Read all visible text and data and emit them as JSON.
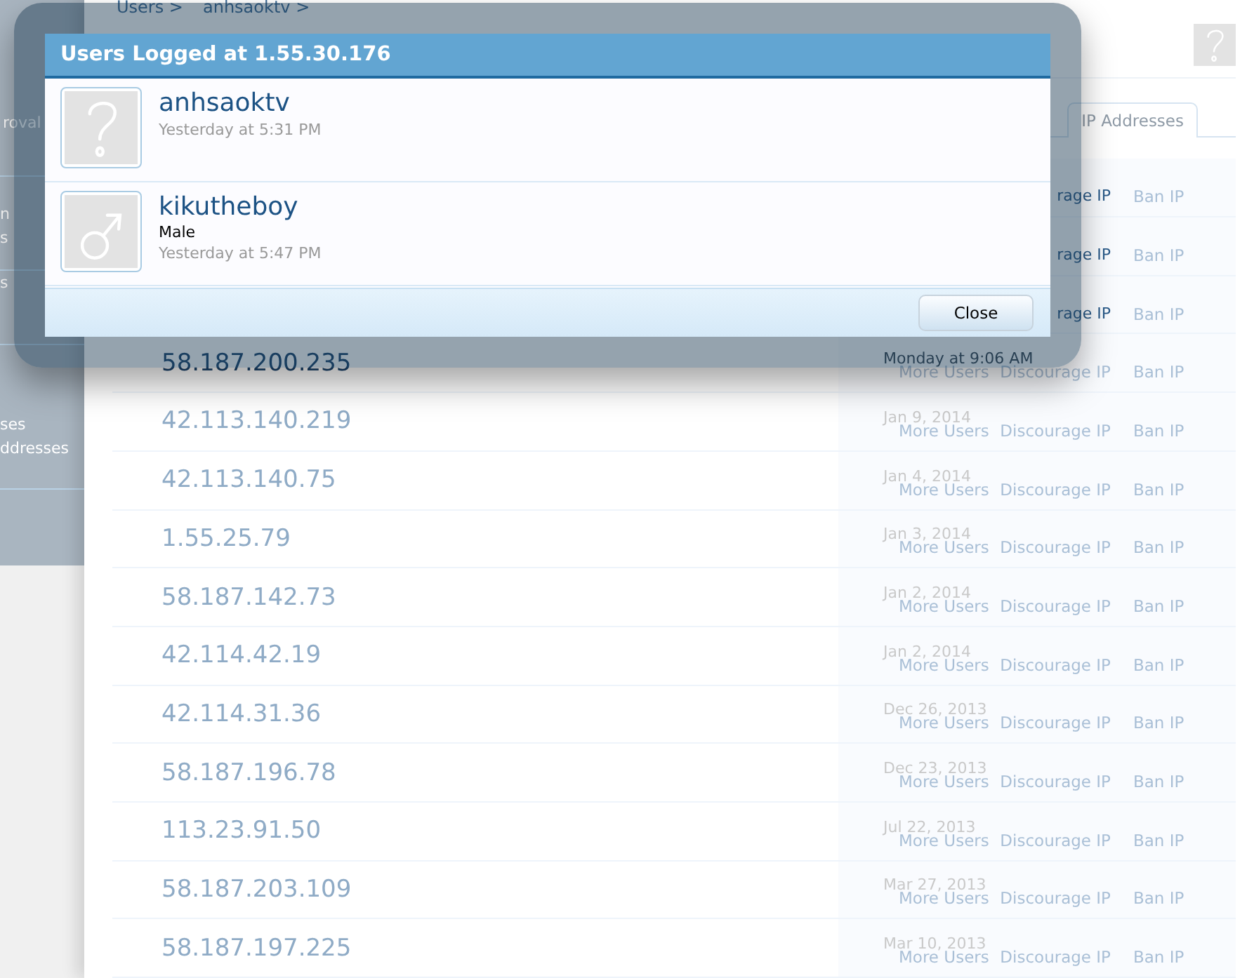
{
  "breadcrumb": [
    {
      "label": "Users >"
    },
    {
      "label": "anhsaoktv >"
    }
  ],
  "sidebar": {
    "sections": [
      {
        "items": [
          "roval"
        ]
      },
      {
        "items": [
          "n",
          "s"
        ]
      },
      {
        "items": [
          "s"
        ]
      },
      {
        "items": [
          "ses",
          "ddresses"
        ]
      }
    ]
  },
  "tabs": [
    {
      "label": "IP Addresses",
      "selected": true
    }
  ],
  "ip_rows": [
    {
      "discourage": "rage IP",
      "ban": "Ban IP"
    },
    {
      "discourage": "rage IP",
      "ban": "Ban IP"
    },
    {
      "discourage": "rage IP",
      "ban": "Ban IP"
    },
    {
      "ip": "58.187.200.235",
      "date": "Monday at 9:06 AM",
      "more": "More Users",
      "discourage": "Discourage IP",
      "ban": "Ban IP"
    },
    {
      "ip": "42.113.140.219",
      "date": "Jan 9, 2014",
      "more": "More Users",
      "discourage": "Discourage IP",
      "ban": "Ban IP"
    },
    {
      "ip": "42.113.140.75",
      "date": "Jan 4, 2014",
      "more": "More Users",
      "discourage": "Discourage IP",
      "ban": "Ban IP"
    },
    {
      "ip": "1.55.25.79",
      "date": "Jan 3, 2014",
      "more": "More Users",
      "discourage": "Discourage IP",
      "ban": "Ban IP"
    },
    {
      "ip": "58.187.142.73",
      "date": "Jan 2, 2014",
      "more": "More Users",
      "discourage": "Discourage IP",
      "ban": "Ban IP"
    },
    {
      "ip": "42.114.42.19",
      "date": "Jan 2, 2014",
      "more": "More Users",
      "discourage": "Discourage IP",
      "ban": "Ban IP"
    },
    {
      "ip": "42.114.31.36",
      "date": "Dec 26, 2013",
      "more": "More Users",
      "discourage": "Discourage IP",
      "ban": "Ban IP"
    },
    {
      "ip": "58.187.196.78",
      "date": "Dec 23, 2013",
      "more": "More Users",
      "discourage": "Discourage IP",
      "ban": "Ban IP"
    },
    {
      "ip": "113.23.91.50",
      "date": "Jul 22, 2013",
      "more": "More Users",
      "discourage": "Discourage IP",
      "ban": "Ban IP"
    },
    {
      "ip": "58.187.203.109",
      "date": "Mar 27, 2013",
      "more": "More Users",
      "discourage": "Discourage IP",
      "ban": "Ban IP"
    },
    {
      "ip": "58.187.197.225",
      "date": "Mar 10, 2013",
      "more": "More Users",
      "discourage": "Discourage IP",
      "ban": "Ban IP"
    }
  ],
  "dialog": {
    "title": "Users Logged at 1.55.30.176",
    "users": [
      {
        "name": "anhsaoktv",
        "kind": "unknown",
        "time": "Yesterday at 5:31 PM"
      },
      {
        "name": "kikutheboy",
        "kind": "male",
        "gender": "Male",
        "time": "Yesterday at 5:47 PM"
      }
    ],
    "buttons": [
      "Close"
    ]
  }
}
